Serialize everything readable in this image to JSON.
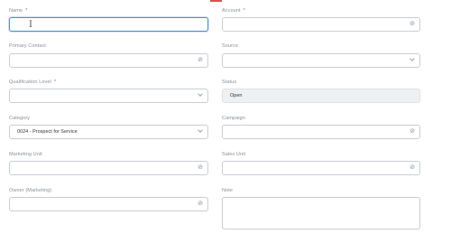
{
  "form": {
    "name": {
      "label": "Name",
      "required_mark": "*",
      "value": ""
    },
    "account": {
      "label": "Account",
      "required_mark": "*",
      "value": "",
      "icon": "link-icon"
    },
    "primary_contact": {
      "label": "Primary Contact",
      "value": "",
      "icon": "link-icon"
    },
    "source": {
      "label": "Source",
      "value": "",
      "icon": "chevron-down-icon"
    },
    "qualification_level": {
      "label": "Qualification Level",
      "required_mark": "*",
      "value": "",
      "icon": "chevron-down-icon"
    },
    "status": {
      "label": "Status",
      "value": "Open"
    },
    "category": {
      "label": "Category",
      "value": "0024 - Prospect for Service",
      "icon": "chevron-down-icon"
    },
    "campaign": {
      "label": "Campaign",
      "value": "",
      "icon": "link-icon"
    },
    "marketing_unit": {
      "label": "Marketing Unit",
      "value": "",
      "icon": "link-icon"
    },
    "sales_unit": {
      "label": "Sales Unit",
      "value": "",
      "icon": "link-icon"
    },
    "owner_marketing": {
      "label": "Owner (Marketing)",
      "value": "",
      "icon": "link-icon"
    },
    "note": {
      "label": "Note",
      "value": ""
    }
  },
  "colors": {
    "accent": "#4a8fd8",
    "required": "#e05050",
    "topbar": "#d9534f"
  }
}
